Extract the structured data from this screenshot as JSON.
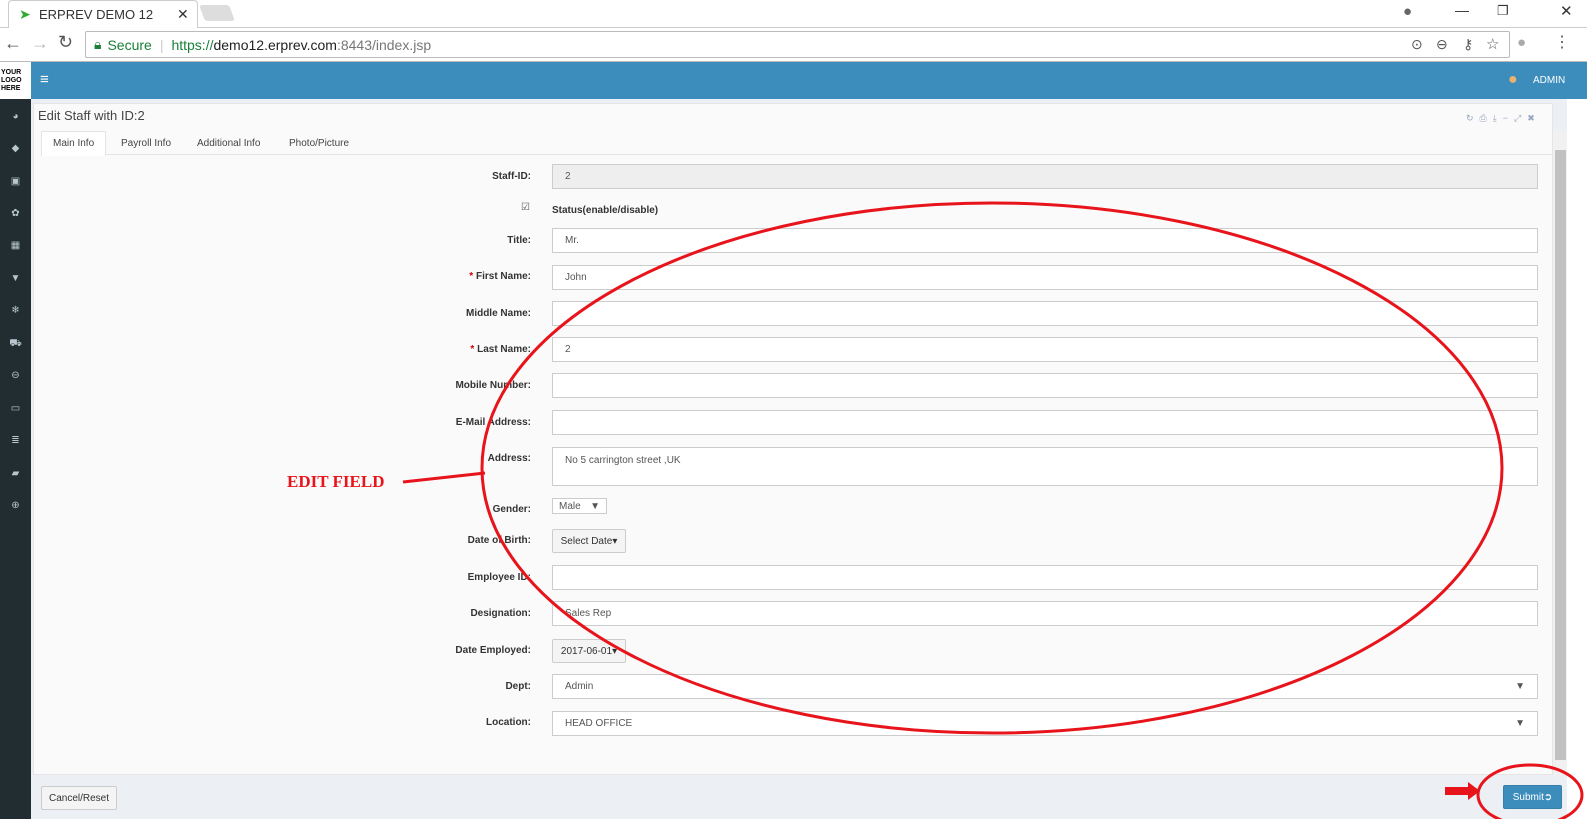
{
  "browser": {
    "tab_title": "ERPREV DEMO 12",
    "secure_label": "Secure",
    "url_scheme": "https://",
    "url_host": "demo12.erprev.com",
    "url_rest": ":8443/index.jsp"
  },
  "header": {
    "logo": "YOUR LOGO HERE",
    "user": "ADMIN",
    "menu_icon": "hamburger-icon"
  },
  "page": {
    "title": "Edit Staff with ID:2",
    "tabs": [
      "Main Info",
      "Payroll Info",
      "Additional Info",
      "Photo/Picture"
    ]
  },
  "form": {
    "staff_id": {
      "label": "Staff-ID:",
      "value": "2"
    },
    "status": {
      "label": "Status(enable/disable)",
      "checked": true
    },
    "title": {
      "label": "Title:",
      "value": "Mr."
    },
    "first_name": {
      "label": "First Name:",
      "value": "John",
      "required": "*"
    },
    "middle_name": {
      "label": "Middle Name:",
      "value": ""
    },
    "last_name": {
      "label": "Last Name:",
      "value": "2",
      "required": "*"
    },
    "mobile": {
      "label": "Mobile Number:",
      "value": ""
    },
    "email": {
      "label": "E-Mail Address:",
      "value": ""
    },
    "address": {
      "label": "Address:",
      "value": "No 5 carrington street ,UK"
    },
    "gender": {
      "label": "Gender:",
      "value": "Male"
    },
    "dob": {
      "label": "Date of Birth:",
      "value": "Select Date"
    },
    "employee_id": {
      "label": "Employee ID:",
      "value": ""
    },
    "designation": {
      "label": "Designation:",
      "value": "Sales Rep"
    },
    "date_employed": {
      "label": "Date Employed:",
      "value": "2017-06-01"
    },
    "dept": {
      "label": "Dept:",
      "value": "Admin"
    },
    "location": {
      "label": "Location:",
      "value": "HEAD OFFICE"
    }
  },
  "footer": {
    "cancel": "Cancel/Reset",
    "submit": "Submit"
  },
  "annotation": {
    "text": "EDIT FIELD",
    "color": "#e8141c"
  }
}
